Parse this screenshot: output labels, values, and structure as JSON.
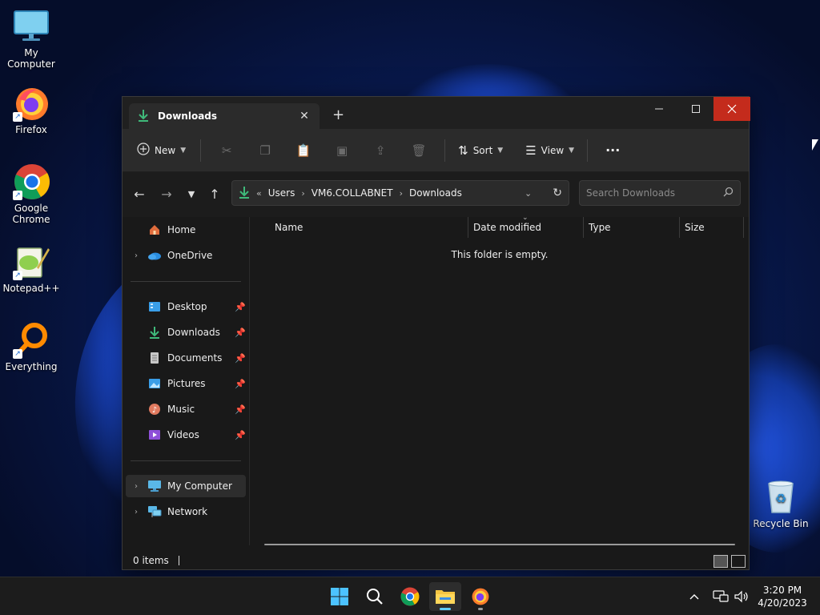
{
  "desktop": {
    "icons": [
      {
        "label": "My Computer"
      },
      {
        "label": "Firefox"
      },
      {
        "label": "Google Chrome"
      },
      {
        "label": "Notepad++"
      },
      {
        "label": "Everything"
      },
      {
        "label": "Recycle Bin"
      }
    ]
  },
  "window": {
    "tab_title": "Downloads",
    "toolbar": {
      "new_label": "New",
      "sort_label": "Sort",
      "view_label": "View",
      "more_label": "···"
    },
    "address": {
      "overflow": "«",
      "crumbs": [
        "Users",
        "VM6.COLLABNET",
        "Downloads"
      ]
    },
    "search": {
      "placeholder": "Search Downloads"
    },
    "sidebar": {
      "items": [
        {
          "label": "Home"
        },
        {
          "label": "OneDrive"
        },
        {
          "label": "Desktop"
        },
        {
          "label": "Downloads"
        },
        {
          "label": "Documents"
        },
        {
          "label": "Pictures"
        },
        {
          "label": "Music"
        },
        {
          "label": "Videos"
        },
        {
          "label": "My Computer"
        },
        {
          "label": "Network"
        }
      ]
    },
    "columns": [
      "Name",
      "Date modified",
      "Type",
      "Size"
    ],
    "empty_message": "This folder is empty.",
    "status": {
      "items": "0 items"
    }
  },
  "taskbar": {
    "time": "3:20 PM",
    "date": "4/20/2023"
  },
  "colors": {
    "accent": "#60cdff",
    "close_red": "#c42b1c",
    "download_green": "#3fb97a"
  }
}
